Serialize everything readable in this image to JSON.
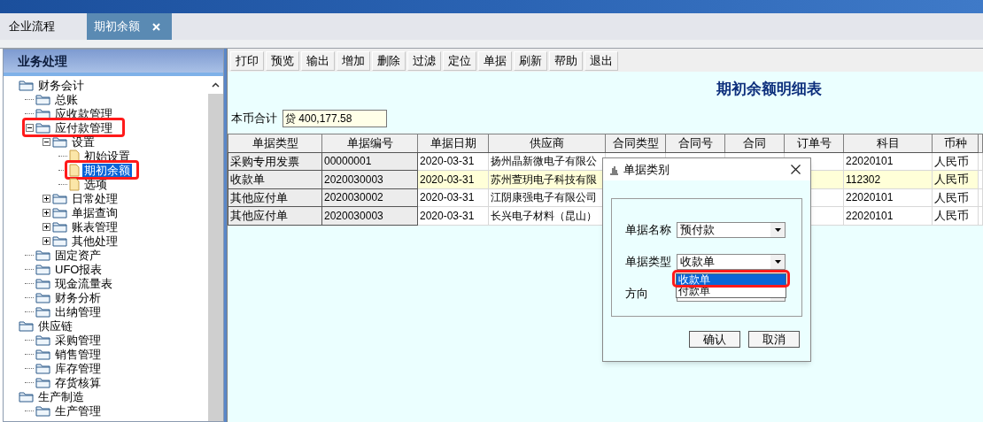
{
  "tabs": [
    {
      "label": "企业流程",
      "selected": false
    },
    {
      "label": "期初余额",
      "selected": true
    }
  ],
  "sidebar": {
    "title": "业务处理",
    "tree": [
      {
        "label": "财务会计",
        "kind": "folder",
        "selected": false,
        "children": [
          {
            "label": "总账",
            "kind": "folder",
            "selected": false
          },
          {
            "label": "应收款管理",
            "kind": "folder",
            "selected": false
          },
          {
            "label": "应付款管理",
            "kind": "folder",
            "selected": false,
            "expanded": true,
            "annotated": true,
            "children": [
              {
                "label": "设置",
                "kind": "folder",
                "selected": false,
                "expanded": true,
                "children": [
                  {
                    "label": "初始设置",
                    "kind": "document",
                    "selected": false
                  },
                  {
                    "label": "期初余额",
                    "kind": "document",
                    "selected": true,
                    "annotated": true
                  },
                  {
                    "label": "选项",
                    "kind": "document",
                    "selected": false
                  }
                ]
              },
              {
                "label": "日常处理",
                "kind": "folder",
                "selected": false,
                "expanded": false
              },
              {
                "label": "单据查询",
                "kind": "folder",
                "selected": false,
                "expanded": false
              },
              {
                "label": "账表管理",
                "kind": "folder",
                "selected": false,
                "expanded": false
              },
              {
                "label": "其他处理",
                "kind": "folder",
                "selected": false,
                "expanded": false
              }
            ]
          },
          {
            "label": "固定资产",
            "kind": "folder",
            "selected": false
          },
          {
            "label": "UFO报表",
            "kind": "folder",
            "selected": false
          },
          {
            "label": "现金流量表",
            "kind": "folder",
            "selected": false
          },
          {
            "label": "财务分析",
            "kind": "folder",
            "selected": false
          },
          {
            "label": "出纳管理",
            "kind": "folder",
            "selected": false
          }
        ]
      },
      {
        "label": "供应链",
        "kind": "folder",
        "selected": false,
        "children": [
          {
            "label": "采购管理",
            "kind": "folder",
            "selected": false
          },
          {
            "label": "销售管理",
            "kind": "folder",
            "selected": false
          },
          {
            "label": "库存管理",
            "kind": "folder",
            "selected": false
          },
          {
            "label": "存货核算",
            "kind": "folder",
            "selected": false
          }
        ]
      },
      {
        "label": "生产制造",
        "kind": "folder",
        "selected": false,
        "children": [
          {
            "label": "生产管理",
            "kind": "folder",
            "selected": false
          }
        ]
      }
    ]
  },
  "toolbar": [
    "打印",
    "预览",
    "输出",
    "增加",
    "删除",
    "过滤",
    "定位",
    "单据",
    "刷新",
    "帮助",
    "退出"
  ],
  "report": {
    "title": "期初余额明细表",
    "total_label": "本币合计",
    "total_value": "贷 400,177.58"
  },
  "table": {
    "columns": [
      "单据类型",
      "单据编号",
      "单据日期",
      "供应商",
      "合同类型",
      "合同号",
      "合同",
      "订单号",
      "科目",
      "币种"
    ],
    "rows": [
      {
        "selected": false,
        "cells": [
          "采购专用发票",
          "00000001",
          "2020-03-31",
          "扬州晶新微电子有限公",
          "",
          "",
          "",
          "",
          "22020101",
          "人民币"
        ]
      },
      {
        "selected": true,
        "cells": [
          "收款单",
          "2020030003",
          "2020-03-31",
          "苏州萱玥电子科技有限",
          "",
          "",
          "",
          "",
          "112302",
          "人民币"
        ]
      },
      {
        "selected": false,
        "cells": [
          "其他应付单",
          "2020030002",
          "2020-03-31",
          "江阴康强电子有限公司",
          "",
          "",
          "",
          "",
          "22020101",
          "人民币"
        ]
      },
      {
        "selected": false,
        "cells": [
          "其他应付单",
          "2020030003",
          "2020-03-31",
          "长兴电子材料（昆山）",
          "",
          "",
          "",
          "",
          "22020101",
          "人民币"
        ]
      }
    ]
  },
  "dialog": {
    "title": "单据类别",
    "fields": [
      {
        "label": "单据名称",
        "value": "预付款"
      },
      {
        "label": "单据类型",
        "value": "收款单"
      },
      {
        "label": "方向"
      }
    ],
    "dropdown": [
      {
        "label": "收款单",
        "selected": true,
        "annotated": true
      },
      {
        "label": "付款单",
        "selected": false,
        "annotated": false
      }
    ],
    "buttons": [
      "确认",
      "取消"
    ]
  }
}
